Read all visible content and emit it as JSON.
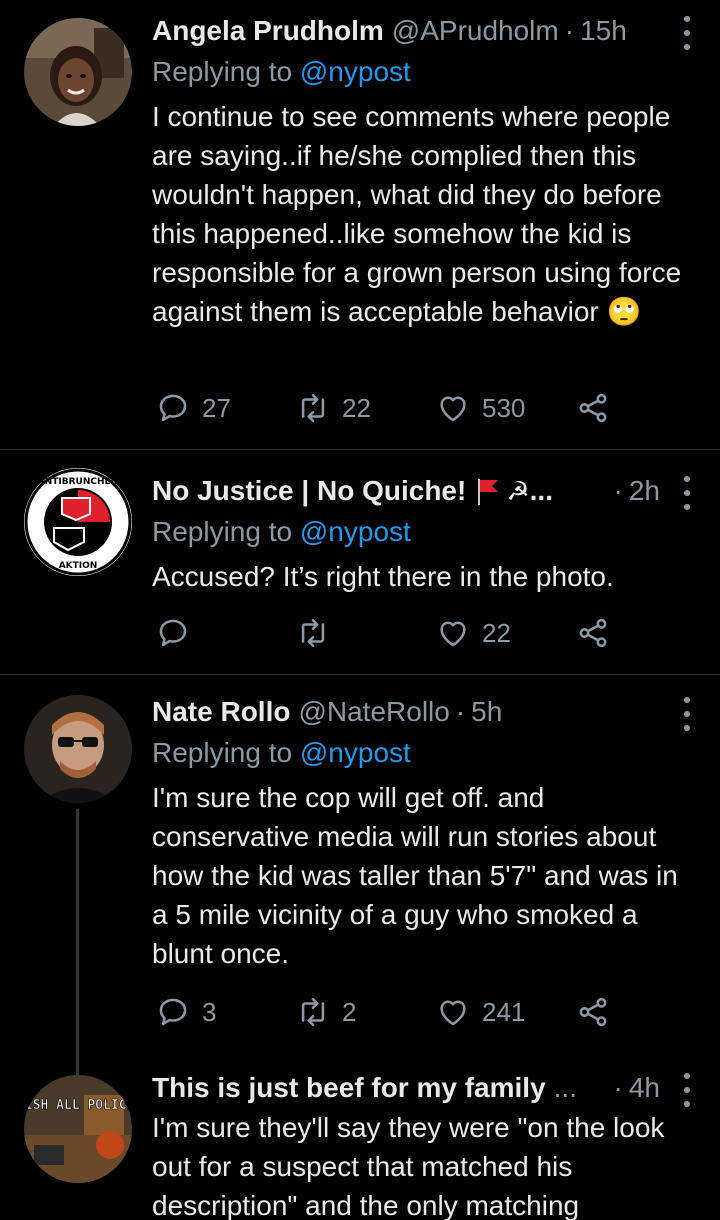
{
  "tweets": [
    {
      "name": "Angela Prudholm",
      "handle": "@APrudholm",
      "time": "15h",
      "replying_prefix": "Replying to",
      "replying_to": "@nypost",
      "text": "I continue to see comments where people are saying..if he/she complied then this wouldn't happen, what did they do before this happened..like somehow the kid is responsible for a grown person using force against them is acceptable behavior",
      "emoji": "🙄",
      "reply_count": "27",
      "retweet_count": "22",
      "like_count": "530"
    },
    {
      "name": "No Justice | No Quiche!",
      "name_suffix": "...",
      "time": "2h",
      "replying_prefix": "Replying to",
      "replying_to": "@nypost",
      "text": "Accused? It’s right there in the photo.",
      "reply_count": "",
      "retweet_count": "",
      "like_count": "22",
      "avatar_text_top": "ANTIBRUNCHEN",
      "avatar_text_bottom": "AKTION"
    },
    {
      "name": "Nate Rollo",
      "handle": "@NateRollo",
      "time": "5h",
      "replying_prefix": "Replying to",
      "replying_to": "@nypost",
      "text": "I'm sure the cop will get off. and conservative media will run stories about how the kid was taller than 5'7\" and was in a 5 mile vicinity of a guy who smoked a blunt once.",
      "reply_count": "3",
      "retweet_count": "2",
      "like_count": "241"
    },
    {
      "name": "This is just beef for my family",
      "name_suffix": "...",
      "time": "4h",
      "text": "I'm sure they'll say they were \"on the look out for a suspect that matched his description\" and the only matching",
      "avatar_text": "ABOLISH ALL POLICE"
    }
  ],
  "colors": {
    "background": "#000000",
    "name": "#e7e9ea",
    "secondary": "#8b98a5",
    "link": "#1d9bf0",
    "divider": "#2f3336"
  },
  "icons": [
    "reply-icon",
    "retweet-icon",
    "like-icon",
    "share-icon",
    "more-icon"
  ]
}
